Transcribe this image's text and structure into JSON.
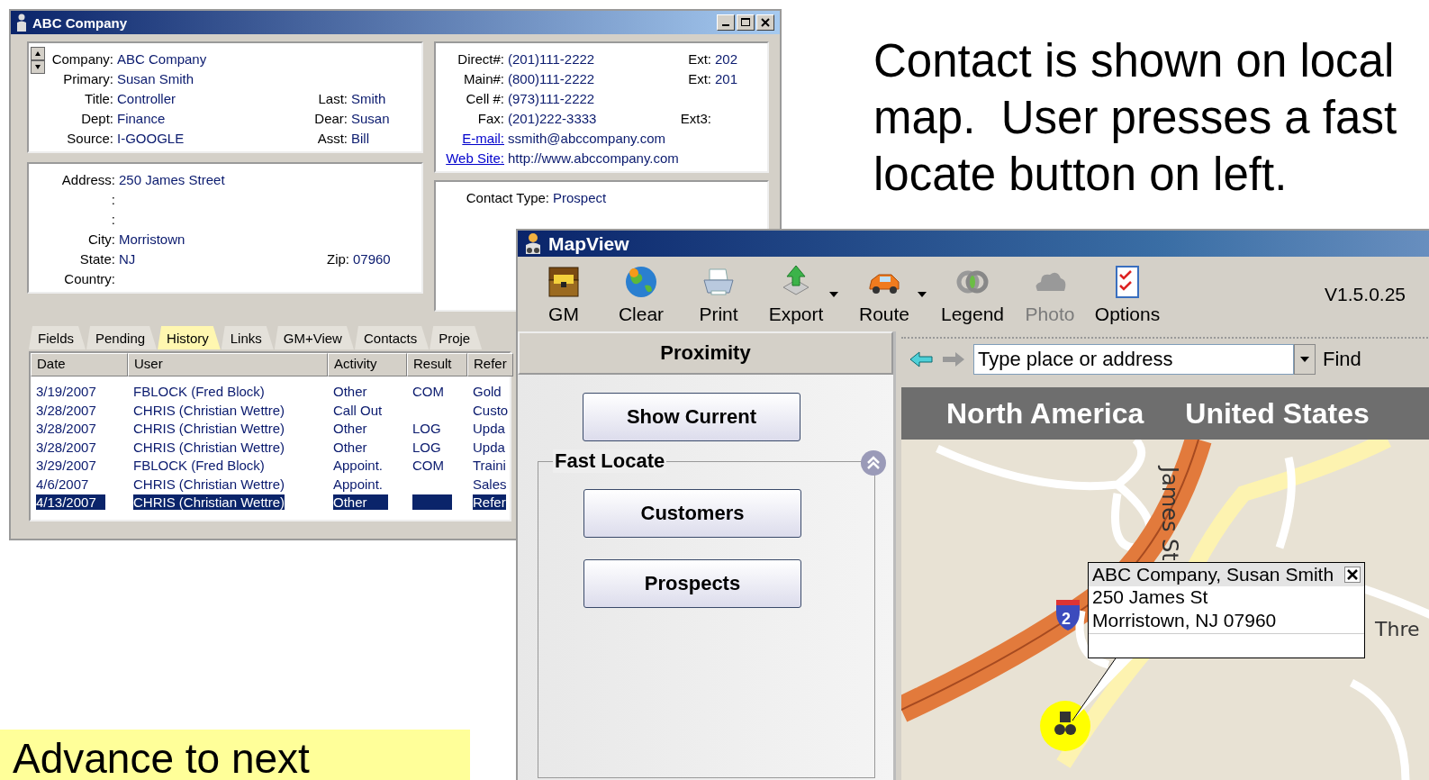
{
  "slide": {
    "caption": "Contact is shown on local\nmap.  User presses a fast\nlocate button on left.",
    "note": "Advance to next"
  },
  "contact_window": {
    "title": "ABC Company",
    "general_panel": [
      [
        {
          "label": "Company:",
          "value": "ABC Company"
        }
      ],
      [
        {
          "label": "Primary:",
          "value": "Susan Smith"
        }
      ],
      [
        {
          "label": "Title:",
          "value": "Controller"
        },
        {
          "label": "Last:",
          "value": "Smith"
        }
      ],
      [
        {
          "label": "Dept:",
          "value": "Finance"
        },
        {
          "label": "Dear:",
          "value": "Susan"
        }
      ],
      [
        {
          "label": "Source:",
          "value": "I-GOOGLE"
        },
        {
          "label": "Asst:",
          "value": "Bill"
        }
      ]
    ],
    "address_panel": [
      [
        {
          "label": "Address:",
          "value": "250 James Street"
        }
      ],
      [
        {
          "label": ":"
        }
      ],
      [
        {
          "label": ":"
        }
      ],
      [
        {
          "label": "City:",
          "value": "Morristown"
        }
      ],
      [
        {
          "label": "State:",
          "value": "NJ"
        },
        {
          "label": "Zip:",
          "value": "07960"
        }
      ],
      [
        {
          "label": "Country:"
        }
      ]
    ],
    "phone_panel": [
      [
        {
          "label": "Direct#:",
          "value": "(201)111-2222"
        },
        {
          "label": "Ext:",
          "value": "202"
        }
      ],
      [
        {
          "label": "Main#:",
          "value": "(800)111-2222"
        },
        {
          "label": "Ext:",
          "value": "201"
        }
      ],
      [
        {
          "label": "Cell #:",
          "value": "(973)111-2222"
        }
      ],
      [
        {
          "label": "Fax:",
          "value": "(201)222-3333"
        },
        {
          "label": "Ext3:"
        }
      ],
      [
        {
          "label": "E-mail:",
          "value": "ssmith@abccompany.com",
          "kind": "link"
        }
      ],
      [
        {
          "label": "Web Site:",
          "value": "http://www.abccompany.com",
          "kind": "link"
        }
      ]
    ],
    "status_panel": [
      [
        {
          "label": "Contact Type:",
          "value": "Prospect"
        }
      ]
    ],
    "tabs": [
      {
        "label": "Fields",
        "selected": false
      },
      {
        "label": "Pending",
        "selected": false
      },
      {
        "label": "History",
        "selected": true
      },
      {
        "label": "Links",
        "selected": false
      },
      {
        "label": "GM+View",
        "selected": false
      },
      {
        "label": "Contacts",
        "selected": false
      },
      {
        "label": "Proje",
        "selected": false
      }
    ],
    "history_table": {
      "columns": [
        "Date",
        "User",
        "Activity",
        "Result",
        "Refer"
      ],
      "rows": [
        {
          "cells": [
            "3/19/2007",
            "FBLOCK (Fred Block)",
            "Other",
            "COM",
            "Gold"
          ],
          "selected": false
        },
        {
          "cells": [
            "3/28/2007",
            "CHRIS (Christian Wettre)",
            "Call Out",
            "",
            "Custo"
          ],
          "selected": false
        },
        {
          "cells": [
            "3/28/2007",
            "CHRIS (Christian Wettre)",
            "Other",
            "LOG",
            "Upda"
          ],
          "selected": false
        },
        {
          "cells": [
            "3/28/2007",
            "CHRIS (Christian Wettre)",
            "Other",
            "LOG",
            "Upda"
          ],
          "selected": false
        },
        {
          "cells": [
            "3/29/2007",
            "FBLOCK (Fred Block)",
            "Appoint.",
            "COM",
            "Traini"
          ],
          "selected": false
        },
        {
          "cells": [
            "4/6/2007",
            "CHRIS (Christian Wettre)",
            "Appoint.",
            "",
            "Sales"
          ],
          "selected": false
        },
        {
          "cells": [
            "4/13/2007",
            "CHRIS (Christian Wettre)",
            "Other",
            "",
            "Refer"
          ],
          "selected": true
        }
      ]
    }
  },
  "mapview_window": {
    "title": "MapView",
    "toolbar": [
      {
        "label": "GM",
        "disabled": false,
        "dropdown": false
      },
      {
        "label": "Clear",
        "disabled": false,
        "dropdown": false
      },
      {
        "label": "Print",
        "disabled": false,
        "dropdown": false
      },
      {
        "label": "Export",
        "disabled": false,
        "dropdown": true
      },
      {
        "label": "Route",
        "disabled": false,
        "dropdown": true
      },
      {
        "label": "Legend",
        "disabled": false,
        "dropdown": false
      },
      {
        "label": "Photo",
        "disabled": true,
        "dropdown": false
      },
      {
        "label": "Options",
        "disabled": false,
        "dropdown": false
      }
    ],
    "version": "V1.5.0.25",
    "proximity": {
      "header": "Proximity",
      "show_current": "Show Current",
      "group_title": "Fast Locate",
      "buttons": [
        "Customers",
        "Prospects"
      ]
    },
    "search": {
      "placeholder": "Type place or address",
      "find": "Find"
    },
    "breadcrumb": [
      "North America",
      "United States"
    ],
    "map": {
      "street_label": "James St",
      "street_label_2": "Thre",
      "shield": "2",
      "popup": {
        "title": "ABC Company, Susan Smith",
        "lines": [
          "250 James St",
          "Morristown, NJ 07960"
        ]
      }
    }
  }
}
